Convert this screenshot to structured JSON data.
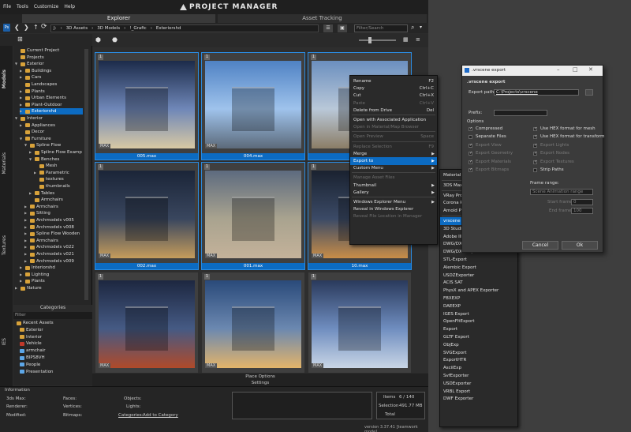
{
  "app": {
    "title": "PROJECT MANAGER",
    "menu": [
      "File",
      "Tools",
      "Customize",
      "Help"
    ],
    "tabs": {
      "explorer": "Explorer",
      "asset_tracking": "Asset Tracking"
    },
    "breadcrumbs": [
      "J:",
      "3D Assets",
      "3D Models",
      "!_Grafic",
      "Exteriorshd"
    ],
    "search_placeholder": "Filter/Search"
  },
  "side_tabs": [
    "Models",
    "Materials",
    "Textures",
    "IES"
  ],
  "tree": [
    {
      "label": "Current Project",
      "level": 0,
      "arrow": ""
    },
    {
      "label": "Projects",
      "level": 0,
      "arrow": ""
    },
    {
      "label": "Exterior",
      "level": 0,
      "arrow": "▼"
    },
    {
      "label": "Buildings",
      "level": 1,
      "arrow": "▶"
    },
    {
      "label": "Cars",
      "level": 1,
      "arrow": "▶"
    },
    {
      "label": "Landscapes",
      "level": 1,
      "arrow": ""
    },
    {
      "label": "Plants",
      "level": 1,
      "arrow": "▶"
    },
    {
      "label": "Urban Elements",
      "level": 1,
      "arrow": "▶"
    },
    {
      "label": "Plant-Outdoor",
      "level": 1,
      "arrow": "▶"
    },
    {
      "label": "Exteriorshd",
      "level": 1,
      "arrow": "▶",
      "selected": true
    },
    {
      "label": "Interior",
      "level": 0,
      "arrow": "▼"
    },
    {
      "label": "Appliances",
      "level": 1,
      "arrow": "▶"
    },
    {
      "label": "Decor",
      "level": 1,
      "arrow": ""
    },
    {
      "label": "Furniture",
      "level": 1,
      "arrow": "▼"
    },
    {
      "label": "Spline Flow",
      "level": 2,
      "arrow": "▼"
    },
    {
      "label": "Spline Flow Examp",
      "level": 3,
      "arrow": "▶"
    },
    {
      "label": "Benches",
      "level": 3,
      "arrow": "▼"
    },
    {
      "label": "Mesh",
      "level": 4,
      "arrow": ""
    },
    {
      "label": "Parametric",
      "level": 4,
      "arrow": "▶"
    },
    {
      "label": "textures",
      "level": 4,
      "arrow": ""
    },
    {
      "label": "thumbnails",
      "level": 4,
      "arrow": ""
    },
    {
      "label": "Tables",
      "level": 3,
      "arrow": "▶"
    },
    {
      "label": "Armchairs",
      "level": 3,
      "arrow": ""
    },
    {
      "label": "Armchairs",
      "level": 2,
      "arrow": "▶"
    },
    {
      "label": "Sitting",
      "level": 2,
      "arrow": "▶"
    },
    {
      "label": "Archmodels v005",
      "level": 2,
      "arrow": "▶"
    },
    {
      "label": "Archmodels v008",
      "level": 2,
      "arrow": "▶"
    },
    {
      "label": "Spline Flow Wooden",
      "level": 2,
      "arrow": "▶"
    },
    {
      "label": "Armchairs",
      "level": 2,
      "arrow": "▶"
    },
    {
      "label": "Archmodels v022",
      "level": 2,
      "arrow": "▶"
    },
    {
      "label": "Archmodels v021",
      "level": 2,
      "arrow": "▶"
    },
    {
      "label": "Archmodels v009",
      "level": 2,
      "arrow": "▶"
    },
    {
      "label": "Interiorshd",
      "level": 1,
      "arrow": "▶"
    },
    {
      "label": "Lighting",
      "level": 1,
      "arrow": "▶"
    },
    {
      "label": "Plants",
      "level": 1,
      "arrow": "▶"
    },
    {
      "label": "Nature",
      "level": 0,
      "arrow": "▶"
    }
  ],
  "categories": {
    "title": "Categories",
    "filter_placeholder": "Filter",
    "items": [
      "Recent Assets",
      "Exterior",
      "Interior",
      "Vehicle",
      "armchair",
      "BIPS8VH",
      "People",
      "Presentation"
    ]
  },
  "grid": [
    {
      "num": "1",
      "name": "005.max",
      "selected": true,
      "badge": "MAX",
      "colors": [
        "#1c2b4a",
        "#6f87b8",
        "#d8c9a4"
      ]
    },
    {
      "num": "1",
      "name": "004.max",
      "selected": true,
      "badge": "MAX",
      "colors": [
        "#4f82c4",
        "#9fc3ec",
        "#5c6a7a"
      ]
    },
    {
      "num": "1",
      "name": "",
      "selected": true,
      "badge": "",
      "colors": [
        "#6b8fbf",
        "#b9c8d8",
        "#8b7d66"
      ]
    },
    {
      "num": "1",
      "name": "002.max",
      "selected": true,
      "badge": "MAX",
      "colors": [
        "#1b2538",
        "#39465e",
        "#c59c5c"
      ]
    },
    {
      "num": "1",
      "name": "001.max",
      "selected": true,
      "badge": "MAX",
      "colors": [
        "#5d6b7f",
        "#a9a38f",
        "#c4b29a"
      ]
    },
    {
      "num": "1",
      "name": "10.max",
      "selected": true,
      "badge": "MAX",
      "colors": [
        "#1a2230",
        "#3b4a66",
        "#c88d48"
      ]
    },
    {
      "num": "1",
      "name": "",
      "selected": false,
      "badge": "MAX",
      "colors": [
        "#1d2740",
        "#455a84",
        "#b04a2a"
      ]
    },
    {
      "num": "1",
      "name": "",
      "selected": false,
      "badge": "MAX",
      "colors": [
        "#2a4a7a",
        "#6b88b0",
        "#e3b46a"
      ]
    },
    {
      "num": "1",
      "name": "",
      "selected": false,
      "badge": "MAX",
      "colors": [
        "#2a3a5c",
        "#6f8dbf",
        "#c9d6e6"
      ]
    }
  ],
  "bottom_bars": {
    "place_options": "Place Options",
    "settings": "Settings"
  },
  "info": {
    "title": "Information",
    "fields": {
      "max3ds": "3ds Max:",
      "renderer": "Renderer:",
      "modified": "Modified:",
      "faces": "Faces:",
      "vertices": "Vertices:",
      "bitmaps": "Bitmaps:",
      "objects": "Objects:",
      "lights": "Lights:",
      "categories": "Categories:",
      "add_category": "Add to Category"
    },
    "items_label": "Items",
    "items_value": "6 / 140",
    "selection_label": "Selection",
    "selection_value": "491.77 MB",
    "total_label": "Total",
    "version": "version 3.37.41 [teamwork mode]"
  },
  "context_menu": [
    {
      "label": "Rename",
      "shortcut": "F2",
      "disabled": false
    },
    {
      "label": "Copy",
      "shortcut": "Ctrl+C",
      "disabled": false
    },
    {
      "label": "Cut",
      "shortcut": "Ctrl+X",
      "disabled": false
    },
    {
      "label": "Paste",
      "shortcut": "Ctrl+V",
      "disabled": true
    },
    {
      "label": "Delete from Drive",
      "shortcut": "Del",
      "disabled": false
    },
    {
      "sep": true
    },
    {
      "label": "Open with Associated Application",
      "shortcut": "",
      "disabled": false
    },
    {
      "label": "Open in Material/Map Browser",
      "shortcut": "",
      "disabled": true
    },
    {
      "sep": true
    },
    {
      "label": "Open Preview",
      "shortcut": "Space",
      "disabled": true
    },
    {
      "sep": true
    },
    {
      "label": "Replace Selection",
      "shortcut": "F9",
      "disabled": true
    },
    {
      "label": "Merge",
      "shortcut": "",
      "disabled": false,
      "sub": true
    },
    {
      "label": "Export to",
      "shortcut": "",
      "disabled": false,
      "sub": true,
      "highlight": true
    },
    {
      "label": "Custom Menu",
      "shortcut": "",
      "disabled": false,
      "sub": true
    },
    {
      "sep": true
    },
    {
      "label": "Manage Asset Files",
      "shortcut": "",
      "disabled": true
    },
    {
      "label": "Thumbnail",
      "shortcut": "",
      "disabled": false,
      "sub": true
    },
    {
      "label": "Gallery",
      "shortcut": "",
      "disabled": false,
      "sub": true
    },
    {
      "sep": true
    },
    {
      "label": "Windows Explorer Menu",
      "shortcut": "",
      "disabled": false,
      "sub": true
    },
    {
      "label": "Reveal in Windows Explorer",
      "shortcut": "",
      "disabled": false
    },
    {
      "label": "Reveal File Location in Manager",
      "shortcut": "",
      "disabled": true
    }
  ],
  "export_menu": [
    {
      "label": "Material Library"
    },
    {
      "sep": true
    },
    {
      "label": "3DS Max version..."
    },
    {
      "sep": true
    },
    {
      "label": "VRay Proxy"
    },
    {
      "label": "Corona Proxy"
    },
    {
      "label": "Arnold Proxy"
    },
    {
      "sep": true
    },
    {
      "label": "vrscene",
      "highlight": true
    },
    {
      "label": "3D Studio"
    },
    {
      "label": "Adobe Illustrator"
    },
    {
      "label": "DWG/DXF Export"
    },
    {
      "label": "DWG/DXF Export"
    },
    {
      "label": "STL-Export"
    },
    {
      "label": "Alembic Export"
    },
    {
      "label": "USDZExporter"
    },
    {
      "label": "ACIS SAT"
    },
    {
      "label": "PhysX and APEX Exporter"
    },
    {
      "label": "FBXEXP"
    },
    {
      "label": "DAEEXP"
    },
    {
      "label": "IGES Export"
    },
    {
      "label": "OpenFltExport"
    },
    {
      "label": "Export"
    },
    {
      "label": "GLTF Export"
    },
    {
      "label": "ObjExp"
    },
    {
      "label": "SVGExport"
    },
    {
      "label": "ExportHTR"
    },
    {
      "label": "AsciiExp"
    },
    {
      "label": "SvfExporter"
    },
    {
      "label": "USDExporter"
    },
    {
      "label": "VRBL Export"
    },
    {
      "label": "DWF Exporter"
    }
  ],
  "dialog": {
    "title": ".vrscene export",
    "heading": ".vrscene export",
    "export_path_label": "Export path:",
    "export_path_value": "C:\\Projects\\vrscene",
    "prefix_label": "Prefix:",
    "options_label": "Options",
    "left_options": [
      {
        "label": "Compressed",
        "checked": true,
        "disabled": false
      },
      {
        "label": "Separate Files",
        "checked": false,
        "disabled": false
      },
      {
        "label": "Export View",
        "checked": true,
        "disabled": true
      },
      {
        "label": "Export Geometry",
        "checked": true,
        "disabled": true
      },
      {
        "label": "Export Materials",
        "checked": true,
        "disabled": true
      },
      {
        "label": "Export Bitmaps",
        "checked": true,
        "disabled": true
      }
    ],
    "right_options": [
      {
        "label": "Use HEX format for mesh",
        "checked": true,
        "disabled": false
      },
      {
        "label": "Use HEX format for transform",
        "checked": true,
        "disabled": false
      },
      {
        "label": "Export Lights",
        "checked": true,
        "disabled": true
      },
      {
        "label": "Export Nodes",
        "checked": true,
        "disabled": true
      },
      {
        "label": "Export Textures",
        "checked": true,
        "disabled": true
      },
      {
        "label": "Strip Paths",
        "checked": false,
        "disabled": false
      }
    ],
    "frame_range_label": "Frame range:",
    "frame_range_value": "Scene Animation range",
    "start_frame_label": "Start frame:",
    "start_frame_value": "0",
    "end_frame_label": "End frame:",
    "end_frame_value": "100",
    "cancel": "Cancel",
    "ok": "Ok"
  }
}
